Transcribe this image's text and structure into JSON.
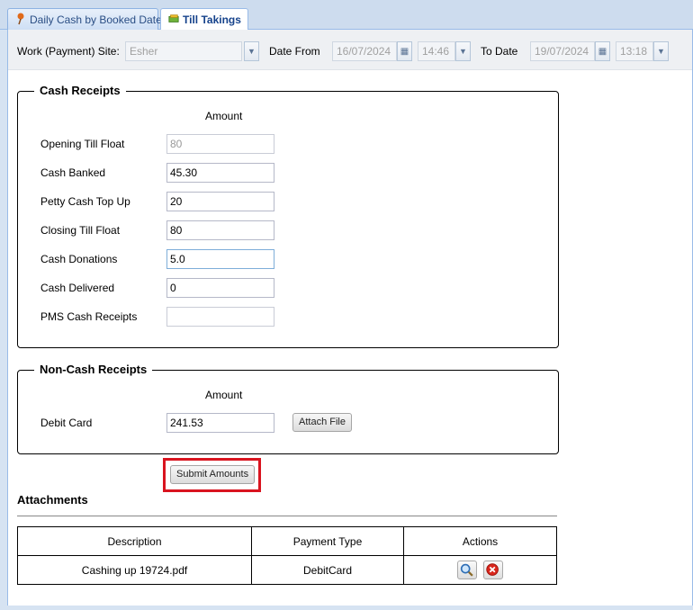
{
  "tabs": [
    {
      "label": "Daily Cash by Booked Date",
      "icon": "pin-icon",
      "active": false
    },
    {
      "label": "Till Takings",
      "icon": "money-icon",
      "active": true
    }
  ],
  "filters": {
    "site_label": "Work (Payment) Site:",
    "site_value": "Esher",
    "date_from_label": "Date From",
    "date_from": "16/07/2024",
    "time_from": "14:46",
    "to_date_label": "To Date",
    "date_to": "19/07/2024",
    "time_to": "13:18"
  },
  "cash_receipts": {
    "title": "Cash Receipts",
    "amount_header": "Amount",
    "rows": [
      {
        "label": "Opening Till Float",
        "value": "80"
      },
      {
        "label": "Cash Banked",
        "value": "45.30"
      },
      {
        "label": "Petty Cash Top Up",
        "value": "20"
      },
      {
        "label": "Closing Till Float",
        "value": "80"
      },
      {
        "label": "Cash Donations",
        "value": "5.0"
      },
      {
        "label": "Cash Delivered",
        "value": "0"
      },
      {
        "label": "PMS Cash Receipts",
        "value": ""
      }
    ]
  },
  "non_cash_receipts": {
    "title": "Non-Cash Receipts",
    "amount_header": "Amount",
    "debit_label": "Debit Card",
    "debit_value": "241.53",
    "attach_label": "Attach File"
  },
  "submit_label": "Submit Amounts",
  "attachments": {
    "title": "Attachments",
    "columns": [
      "Description",
      "Payment Type",
      "Actions"
    ],
    "rows": [
      {
        "description": "Cashing up 19724.pdf",
        "payment_type": "DebitCard"
      }
    ]
  },
  "colors": {
    "highlight": "#d9141f",
    "tab_text": "#15428b"
  }
}
